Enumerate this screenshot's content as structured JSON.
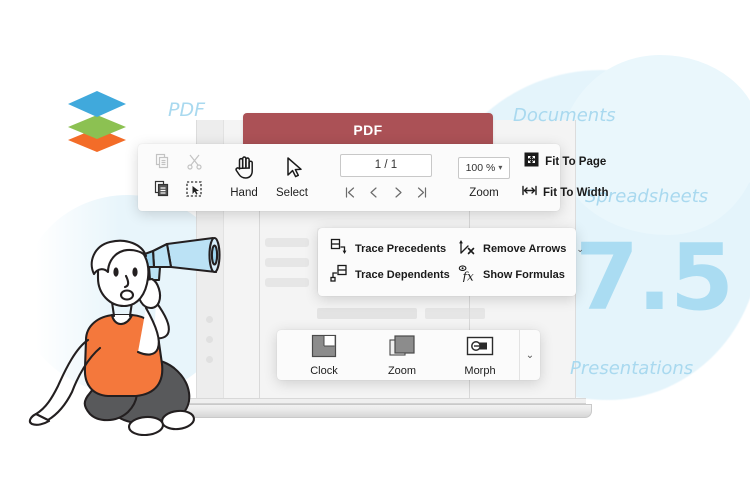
{
  "brand": {
    "logo_name": "onlyoffice-layers-logo",
    "logo_colors": [
      "#40A9DC",
      "#8CC152",
      "#F36C28"
    ],
    "version": "7.5",
    "version_color": "#AADCF2"
  },
  "categories": [
    {
      "id": "pdf",
      "label": "PDF"
    },
    {
      "id": "documents",
      "label": "Documents"
    },
    {
      "id": "spreadsheets",
      "label": "Spreadsheets"
    },
    {
      "id": "presentations",
      "label": "Presentations"
    }
  ],
  "pdf_tab": {
    "label": "PDF",
    "color": "#AB5156"
  },
  "pdf_toolbar": {
    "clipboard": [
      {
        "name": "copy-icon",
        "label": "Copy",
        "state": "disabled"
      },
      {
        "name": "cut-icon",
        "label": "Cut",
        "state": "disabled"
      },
      {
        "name": "paste-icon",
        "label": "Paste",
        "state": "enabled"
      },
      {
        "name": "select-all-icon",
        "label": "Select All",
        "state": "enabled"
      }
    ],
    "tools": [
      {
        "name": "hand-tool",
        "label": "Hand"
      },
      {
        "name": "select-tool",
        "label": "Select"
      }
    ],
    "pages": {
      "value": "1 / 1",
      "placeholder": "1 / 1",
      "nav": [
        {
          "name": "first-page-button",
          "glyph": "|<"
        },
        {
          "name": "previous-page-button",
          "glyph": "<"
        },
        {
          "name": "next-page-button",
          "glyph": ">"
        },
        {
          "name": "last-page-button",
          "glyph": ">|"
        }
      ]
    },
    "zoom": {
      "value": "100 %",
      "label": "Zoom",
      "fit_to_page": "Fit To Page",
      "fit_to_width": "Fit To Width"
    }
  },
  "formulas_toolbar": {
    "items": [
      {
        "name": "trace-precedents-button",
        "label": "Trace Precedents",
        "caret": false
      },
      {
        "name": "remove-arrows-button",
        "label": "Remove Arrows",
        "caret": true,
        "caret_glyph": "⌄"
      },
      {
        "name": "trace-dependents-button",
        "label": "Trace Dependents",
        "caret": false
      },
      {
        "name": "show-formulas-button",
        "label": "Show Formulas",
        "caret": false
      }
    ]
  },
  "animations_toolbar": {
    "items": [
      {
        "name": "animation-clock",
        "label": "Clock"
      },
      {
        "name": "animation-zoom",
        "label": "Zoom"
      },
      {
        "name": "animation-morph",
        "label": "Morph"
      }
    ],
    "more_glyph": "⌄"
  },
  "illustration": {
    "name": "person-with-megaphone",
    "shirt_color": "#F4783C",
    "pants_color": "#58595B",
    "megaphone_color": "#BBE2F5"
  },
  "background": {
    "blob_color": "#E4F4FB",
    "screen_color": "#F4F4F4"
  }
}
